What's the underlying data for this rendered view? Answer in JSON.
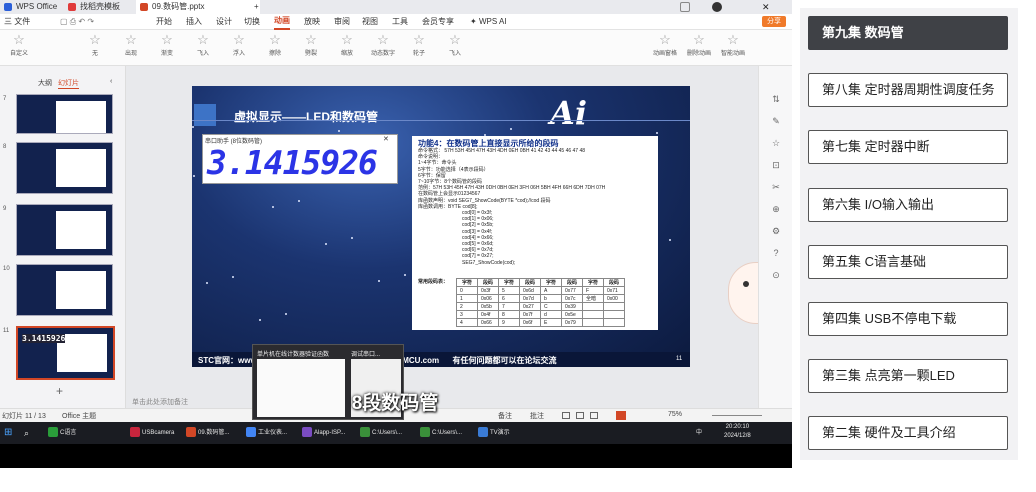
{
  "tabs": {
    "wps": "WPS Office",
    "t2": "找稻壳模板",
    "t3": "09.数码管.pptx",
    "plus": "+"
  },
  "window_buttons": {
    "share": "分享"
  },
  "menu": {
    "file": "三 文件",
    "items": [
      "开始",
      "插入",
      "设计",
      "切换",
      "动画",
      "放映",
      "审阅",
      "视图",
      "工具",
      "会员专享"
    ],
    "active_index": 4,
    "wps_ai": "WPS AI"
  },
  "ribbon": {
    "items": [
      "自定义",
      "无",
      "出现",
      "渐变",
      "飞入",
      "浮入",
      "擦除",
      "劈裂",
      "缩放",
      "动态数字",
      "轮子",
      "飞入"
    ],
    "right": [
      "动画窗格",
      "删除动画",
      "智能动画"
    ]
  },
  "left_panel": {
    "tab_outline": "大纲",
    "tab_slides": "幻灯片",
    "slide_numbers": [
      "7",
      "8",
      "9",
      "10",
      "11"
    ],
    "thumb11_digits": "3.1415926",
    "add": "+"
  },
  "slide": {
    "title": "虚拟显示——LED和数码管",
    "logo": "Ai",
    "led_window_title": "串口助手 (8位数码管)",
    "led_digits": "3.1415926",
    "func_title": "功能4：在数码管上直接显示所给的段码",
    "footer_left": "STC官网：www.",
    "footer_right": "IMCU.com      有任何问题都可以在论坛交流",
    "page_num": "11",
    "code_lines": [
      "命令格式： 57H 53H 45H 47H 43H 4DH 0EH 0BH 41 42 43 44 45 46 47 48",
      "命令说明：",
      "1~4字节：命令头",
      "5字节：功能选择（4表示段码）",
      "6字节：保留",
      "7~10字节：8个数码管的段码",
      "范例：57H 53H 45H 47H 43H 0DH 0BH 0EH 3FH 06H 5BH 4FH 66H 6DH 7DH 07H",
      "在数码管上会显示01234567",
      "库函数声明：void SEG7_ShowCode(BYTE *cod);//cod 段码",
      "库函数调用：BYTE cod[8];",
      "cod[0] = 0x3f;",
      "cod[1] = 0x06;",
      "cod[2] = 0x5b;",
      "cod[3] = 0x4f;",
      "cod[4] = 0x66;",
      "cod[5] = 0x6d;",
      "cod[6] = 0x7d;",
      "cod[7] = 0x27;",
      "SEG7_ShowCode(cod);"
    ],
    "table_label": "常用段码表：",
    "table_headers": [
      "字符",
      "段码",
      "字符",
      "段码",
      "字符",
      "段码",
      "字符",
      "段码"
    ],
    "table_rows": [
      [
        "0",
        "0x3f",
        "5",
        "0x6d",
        "A",
        "0x77",
        "F",
        "0x71"
      ],
      [
        "1",
        "0x06",
        "6",
        "0x7d",
        "b",
        "0x7c",
        "全暗",
        "0x00"
      ],
      [
        "2",
        "0x5b",
        "7",
        "0x27",
        "C",
        "0x39",
        "",
        ""
      ],
      [
        "3",
        "0x4f",
        "8",
        "0x7f",
        "d",
        "0x5e",
        "",
        ""
      ],
      [
        "4",
        "0x66",
        "9",
        "0x6f",
        "E",
        "0x79",
        "",
        ""
      ]
    ]
  },
  "status": {
    "left": "幻灯片 11 / 13",
    "theme": "Office 主题",
    "notes_hint": "单击此处添加备注",
    "remarks": "备注",
    "comment": "批注",
    "zoom": "75%"
  },
  "popup": {
    "item1": "单片机在线计数器验证函数",
    "item2": "调试串口..."
  },
  "subtitle": "8段数码管",
  "taskbar": {
    "items": [
      "C语言",
      "USBcamera",
      "09.数码管...",
      "工业仪表...",
      "Alapp-ISP...",
      "C:\\Users\\...",
      "C:\\Users\\...",
      "TV演示"
    ],
    "time": "20:20:10",
    "date": "2024/12/8",
    "lang": "中"
  },
  "sidebar": {
    "episodes": [
      "第九集 数码管",
      "第八集 定时器周期性调度任务",
      "第七集 定时器中断",
      "第六集 I/O输入输出",
      "第五集 C语言基础",
      "第四集 USB不停电下载",
      "第三集 点亮第一颗LED",
      "第二集 硬件及工具介绍"
    ],
    "active_index": 0
  },
  "colors": {
    "accent": "#d24726",
    "sidebar_active": "#3f4146",
    "led_digit": "#2b34e6",
    "slide_bg": "#12224e"
  }
}
